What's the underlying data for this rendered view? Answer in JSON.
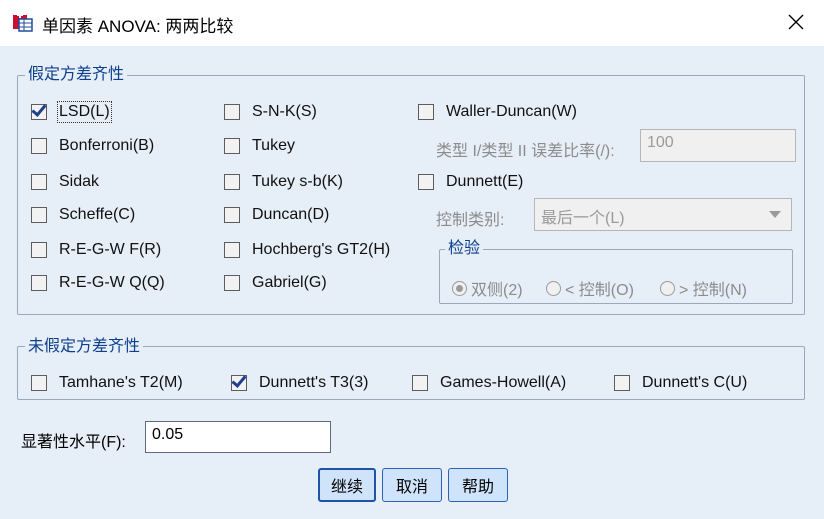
{
  "window": {
    "title": "单因素 ANOVA: 两两比较"
  },
  "equal_variances": {
    "label": "假定方差齐性",
    "col1": [
      {
        "label": "LSD(L)",
        "checked": true
      },
      {
        "label": "Bonferroni(B)",
        "checked": false
      },
      {
        "label": "Sidak",
        "checked": false
      },
      {
        "label": "Scheffe(C)",
        "checked": false
      },
      {
        "label": "R-E-G-W F(R)",
        "checked": false
      },
      {
        "label": "R-E-G-W Q(Q)",
        "checked": false
      }
    ],
    "col2": [
      {
        "label": "S-N-K(S)",
        "checked": false
      },
      {
        "label": "Tukey",
        "checked": false
      },
      {
        "label": "Tukey s-b(K)",
        "checked": false
      },
      {
        "label": "Duncan(D)",
        "checked": false
      },
      {
        "label": "Hochberg's GT2(H)",
        "checked": false
      },
      {
        "label": "Gabriel(G)",
        "checked": false
      }
    ],
    "waller": {
      "label": "Waller-Duncan(W)",
      "checked": false
    },
    "ratio_label": "类型 I/类型 II 误差比率(/):",
    "ratio_value": "100",
    "dunnett": {
      "label": "Dunnett(E)",
      "checked": false
    },
    "control_label": "控制类别:",
    "control_value": "最后一个(L)",
    "test": {
      "label": "检验",
      "options": [
        {
          "label": "双侧(2)",
          "selected": true
        },
        {
          "label": "< 控制(O)",
          "selected": false
        },
        {
          "label": "> 控制(N)",
          "selected": false
        }
      ]
    }
  },
  "unequal_variances": {
    "label": "未假定方差齐性",
    "items": [
      {
        "label": "Tamhane's T2(M)",
        "checked": false
      },
      {
        "label": "Dunnett's T3(3)",
        "checked": true
      },
      {
        "label": "Games-Howell(A)",
        "checked": false
      },
      {
        "label": "Dunnett's C(U)",
        "checked": false
      }
    ]
  },
  "significance": {
    "label": "显著性水平(F):",
    "value": "0.05"
  },
  "buttons": {
    "continue": "继续",
    "cancel": "取消",
    "help": "帮助"
  },
  "colors": {
    "accent": "#0d3f8c",
    "background": "#e6eef8",
    "button": "#cfe3fb"
  }
}
